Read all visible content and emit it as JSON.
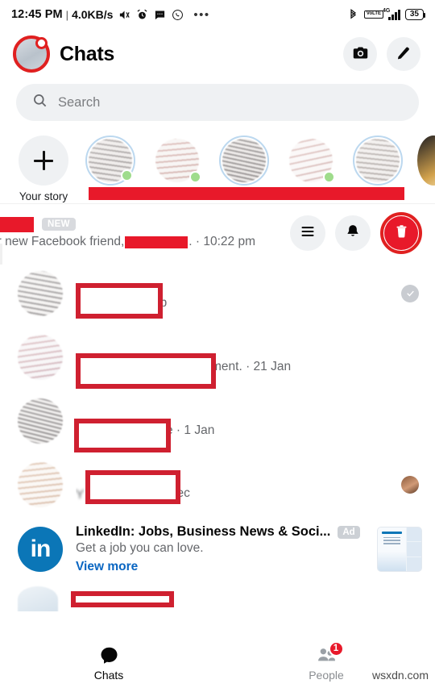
{
  "status_bar": {
    "time": "12:45 PM",
    "separator": "|",
    "net_speed": "4.0KB/s",
    "left_icons": [
      "mute-icon",
      "alarm-icon",
      "sms-icon",
      "whatsapp-icon",
      "more-dots-icon"
    ],
    "right_icons": [
      "bluetooth-icon",
      "volte-icon",
      "signal-icon"
    ],
    "volte_label": "VoLTE",
    "network_type": "4G",
    "battery_level": "35"
  },
  "header": {
    "title": "Chats",
    "avatar_name": "profile-avatar",
    "camera_label": "camera-icon",
    "compose_label": "edit-icon"
  },
  "search": {
    "placeholder": "Search",
    "icon": "search-icon"
  },
  "stories": {
    "your_story_label": "Your story",
    "add_icon": "plus-icon",
    "items": [
      {
        "name": "story-1",
        "active": true,
        "online": true
      },
      {
        "name": "story-2",
        "active": false,
        "online": true
      },
      {
        "name": "story-3",
        "active": true,
        "online": false
      },
      {
        "name": "story-4",
        "active": false,
        "online": true
      },
      {
        "name": "story-5",
        "active": true,
        "online": false
      }
    ]
  },
  "action_row": {
    "badge": "NEW",
    "preview_text_before": "ur new Facebook friend,",
    "preview_text_after": ". · 10:22 pm",
    "time": "10:22 pm",
    "menu_icon": "hamburger-menu-icon",
    "mute_icon": "bell-icon",
    "delete_icon": "trash-icon"
  },
  "chats": [
    {
      "name": "chat-row-1",
      "snippet_tail": "eb",
      "status": "seen-check"
    },
    {
      "name": "chat-row-2",
      "snippet_tail": "ment. · 21 Jan",
      "status": "none"
    },
    {
      "name": "chat-row-3",
      "snippet_tail": "e · 1 Jan",
      "status": "none"
    },
    {
      "name": "chat-row-4",
      "snippet_head": "Y",
      "snippet_tail": "Dec",
      "status": "read-avatar"
    }
  ],
  "ad": {
    "title": "LinkedIn: Jobs, Business News & Soci...",
    "badge": "Ad",
    "subtitle": "Get a job you can love.",
    "link": "View more",
    "logo_text": "in",
    "thumb_name": "ad-thumbnail"
  },
  "bottom_nav": {
    "items": [
      {
        "label": "Chats",
        "icon": "chat-bubble-icon",
        "active": true,
        "badge": ""
      },
      {
        "label": "People",
        "icon": "people-icon",
        "active": false,
        "badge": "1"
      }
    ]
  },
  "watermark": "wsxdn.com",
  "colors": {
    "annotation_red": "#cf2030",
    "redaction_red": "#e8192a",
    "accent_blue": "#0a66c2",
    "linkedin_blue": "#0b76b7",
    "muted_text": "#65676b"
  }
}
